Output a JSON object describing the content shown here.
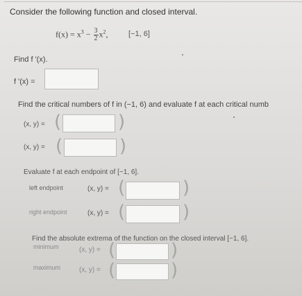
{
  "question": {
    "intro": "Consider the following function and closed interval.",
    "function_prefix": "f(x) = x",
    "function_exp": "3",
    "function_minus": " − ",
    "frac_num": "3",
    "frac_den": "2",
    "function_tail_var": "x",
    "function_tail_exp": "2",
    "function_comma": ",",
    "interval": "[−1, 6]"
  },
  "derivative": {
    "prompt": "Find f '(x).",
    "label": "f '(x) =",
    "value": ""
  },
  "critical": {
    "prompt": "Find the critical numbers of f in (−1, 6) and evaluate f at each critical numb",
    "row1_label": "(x, y) =",
    "row1_value": "",
    "row2_label": "(x, y) =",
    "row2_value": ""
  },
  "endpoints": {
    "prompt": "Evaluate f at each endpoint of [−1, 6].",
    "left_label": "left endpoint",
    "left_xy": "(x, y) =",
    "left_value": "",
    "right_label": "right endpoint",
    "right_xy": "(x, y) =",
    "right_value": ""
  },
  "extrema": {
    "prompt": "Find the absolute extrema of the function on the closed interval [−1, 6].",
    "min_label": "minimum",
    "min_xy": "(x, y) =",
    "min_value": "",
    "max_label": "maximum",
    "max_xy": "(x, y) =",
    "max_value": ""
  },
  "symbols": {
    "open_paren": "(",
    "close_paren": ")"
  }
}
